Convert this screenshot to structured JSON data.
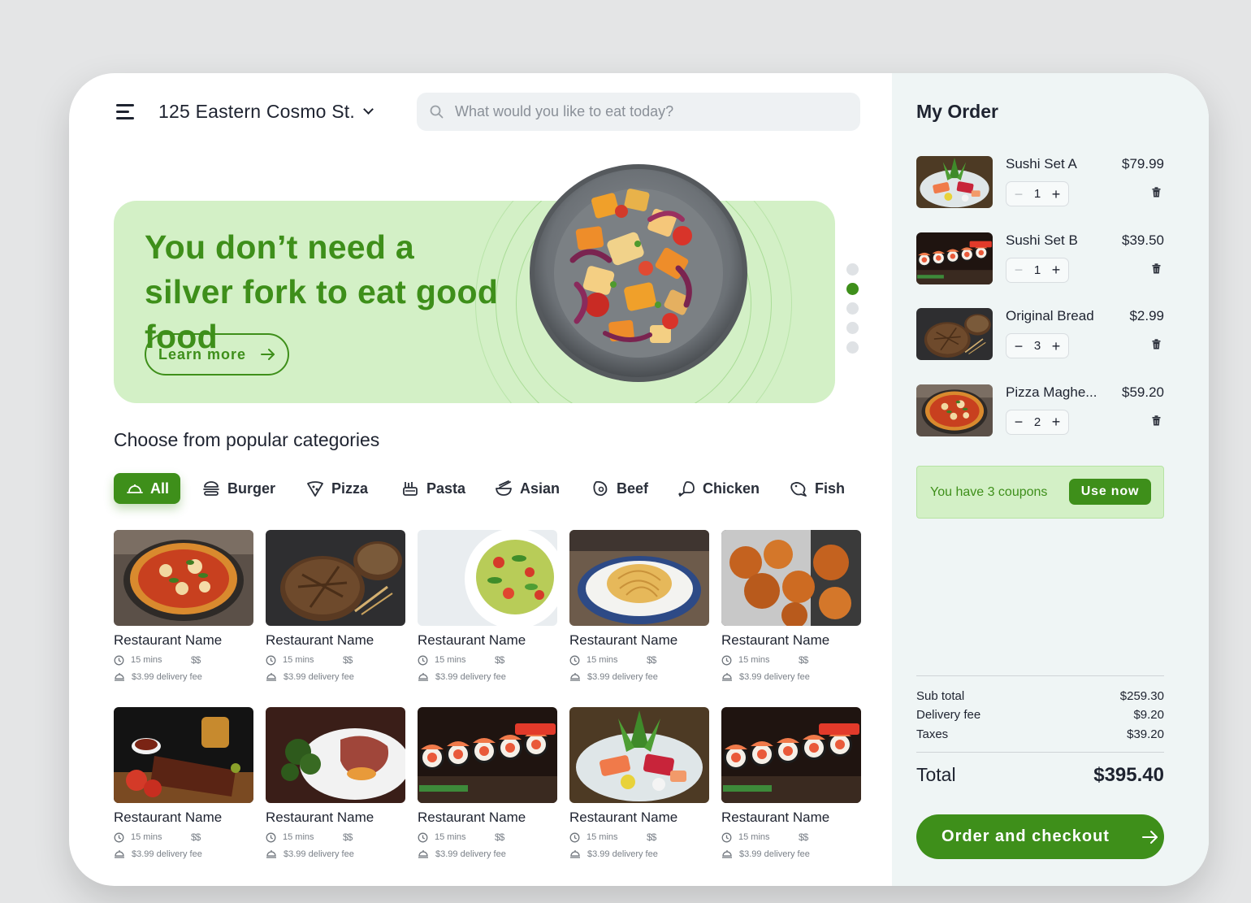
{
  "header": {
    "address": "125 Eastern Cosmo St.",
    "search_placeholder": "What would you like to eat today?"
  },
  "hero": {
    "title": "You don’t need a silver fork to eat good food",
    "button_label": "Learn more",
    "slides_total": 5,
    "slide_active": 2
  },
  "categories": {
    "heading": "Choose from popular categories",
    "items": [
      {
        "label": "All",
        "icon": "dome-icon",
        "active": true
      },
      {
        "label": "Burger",
        "icon": "burger-icon"
      },
      {
        "label": "Pizza",
        "icon": "pizza-icon"
      },
      {
        "label": "Pasta",
        "icon": "pasta-icon"
      },
      {
        "label": "Asian",
        "icon": "noodles-icon"
      },
      {
        "label": "Beef",
        "icon": "beef-icon"
      },
      {
        "label": "Chicken",
        "icon": "chicken-leg-icon"
      },
      {
        "label": "Fish",
        "icon": "fish-icon"
      }
    ]
  },
  "restaurants": [
    {
      "name": "Restaurant Name",
      "time": "15 mins",
      "price": "$$",
      "fee": "$3.99 delivery fee",
      "photo": "pizza"
    },
    {
      "name": "Restaurant Name",
      "time": "15 mins",
      "price": "$$",
      "fee": "$3.99 delivery fee",
      "photo": "bread"
    },
    {
      "name": "Restaurant Name",
      "time": "15 mins",
      "price": "$$",
      "fee": "$3.99 delivery fee",
      "photo": "pasta-salad"
    },
    {
      "name": "Restaurant Name",
      "time": "15 mins",
      "price": "$$",
      "fee": "$3.99 delivery fee",
      "photo": "spaghetti"
    },
    {
      "name": "Restaurant Name",
      "time": "15 mins",
      "price": "$$",
      "fee": "$3.99 delivery fee",
      "photo": "fried-chicken"
    },
    {
      "name": "Restaurant Name",
      "time": "15 mins",
      "price": "$$",
      "fee": "$3.99 delivery fee",
      "photo": "ribs"
    },
    {
      "name": "Restaurant Name",
      "time": "15 mins",
      "price": "$$",
      "fee": "$3.99 delivery fee",
      "photo": "steak"
    },
    {
      "name": "Restaurant Name",
      "time": "15 mins",
      "price": "$$",
      "fee": "$3.99 delivery fee",
      "photo": "sushi-rolls"
    },
    {
      "name": "Restaurant Name",
      "time": "15 mins",
      "price": "$$",
      "fee": "$3.99 delivery fee",
      "photo": "sashimi"
    },
    {
      "name": "Restaurant Name",
      "time": "15 mins",
      "price": "$$",
      "fee": "$3.99 delivery fee",
      "photo": "sushi-rolls"
    }
  ],
  "order": {
    "title": "My Order",
    "items": [
      {
        "name": "Sushi Set A",
        "price": "$79.99",
        "qty": "1",
        "minus": "−",
        "plus": "+",
        "photo": "sashimi"
      },
      {
        "name": "Sushi Set B",
        "price": "$39.50",
        "qty": "1",
        "minus": "−",
        "plus": "+",
        "photo": "sushi-rolls"
      },
      {
        "name": "Original Bread",
        "price": "$2.99",
        "qty": "3",
        "minus": "−",
        "plus": "+",
        "photo": "bread"
      },
      {
        "name": "Pizza Maghe...",
        "price": "$59.20",
        "qty": "2",
        "minus": "−",
        "plus": "+",
        "photo": "pizza"
      }
    ],
    "coupon_text": "You have 3 coupons",
    "coupon_button": "Use now",
    "summary": [
      {
        "label": "Sub total",
        "value": "$259.30"
      },
      {
        "label": "Delivery fee",
        "value": "$9.20"
      },
      {
        "label": "Taxes",
        "value": "$39.20"
      }
    ],
    "total_label": "Total",
    "total_value": "$395.40",
    "checkout_label": "Order and checkout"
  },
  "colors": {
    "accent": "#3e8f1a",
    "hero_bg": "#d3f0c6",
    "sidebar_bg": "#eff5f5"
  }
}
